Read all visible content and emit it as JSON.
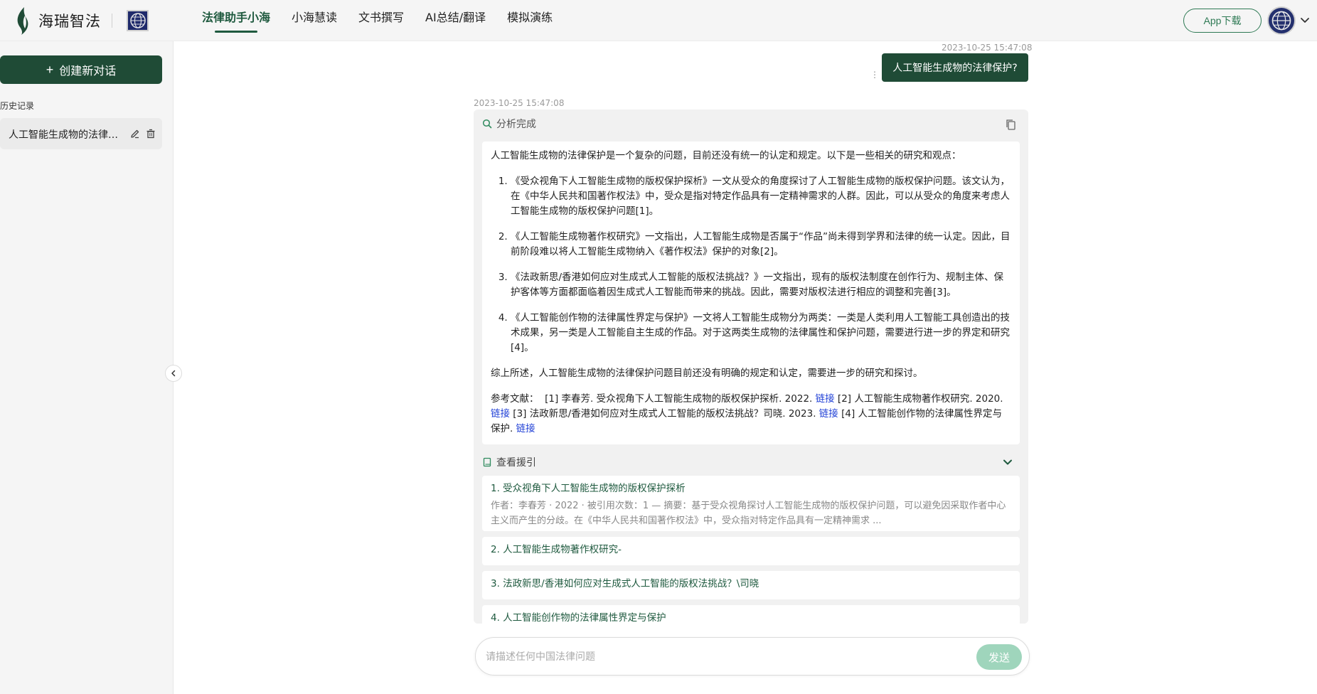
{
  "header": {
    "logo_text": "海瑞智法",
    "nav": [
      {
        "label": "法律助手小海",
        "active": true
      },
      {
        "label": "小海慧读",
        "active": false
      },
      {
        "label": "文书撰写",
        "active": false
      },
      {
        "label": "AI总结/翻译",
        "active": false
      },
      {
        "label": "模拟演练",
        "active": false
      }
    ],
    "app_download": "App下载"
  },
  "sidebar": {
    "new_chat": "创建新对话",
    "history_label": "历史记录",
    "history_items": [
      {
        "label": "人工智能生成物的法律保护?"
      }
    ]
  },
  "conversation": {
    "user_time": "2023-10-25 15:47:08",
    "user_message": "人工智能生成物的法律保护?",
    "answer_time": "2023-10-25 15:47:08",
    "status": "分析完成",
    "intro": "人工智能生成物的法律保护是一个复杂的问题，目前还没有统一的认定和规定。以下是一些相关的研究和观点：",
    "points": [
      "《受众视角下人工智能生成物的版权保护探析》一文从受众的角度探讨了人工智能生成物的版权保护问题。该文认为，在《中华人民共和国著作权法》中，受众是指对特定作品具有一定精神需求的人群。因此，可以从受众的角度来考虑人工智能生成物的版权保护问题[1]。",
      "《人工智能生成物著作权研究》一文指出，人工智能生成物是否属于“作品”尚未得到学界和法律的统一认定。因此，目前阶段难以将人工智能生成物纳入《著作权法》保护的对象[2]。",
      "《法政新思/香港如何应对生成式人工智能的版权法挑战？》一文指出，现有的版权法制度在创作行为、规制主体、保护客体等方面都面临着因生成式人工智能而带来的挑战。因此，需要对版权法进行相应的调整和完善[3]。",
      "《人工智能创作物的法律属性界定与保护》一文将人工智能生成物分为两类：一类是人类利用人工智能工具创造出的技术成果，另一类是人工智能自主生成的作品。对于这两类生成物的法律属性和保护问题，需要进行进一步的界定和研究[4]。"
    ],
    "summary": "综上所述，人工智能生成物的法律保护问题目前还没有明确的规定和认定，需要进一步的研究和探讨。",
    "refs_prefix": "参考文献：",
    "ref_texts": [
      "[1] 李春芳. 受众视角下人工智能生成物的版权保护探析. 2022.",
      "[2] 人工智能生成物著作权研究. 2020.",
      "[3] 法政新思/香港如何应对生成式人工智能的版权法挑战？司晓. 2023.",
      "[4] 人工智能创作物的法律属性界定与保护."
    ],
    "link_label": "链接",
    "citations_label": "查看援引",
    "citations": [
      {
        "title": "1. 受众视角下人工智能生成物的版权保护探析",
        "meta": "作者：李春芳 · 2022 · 被引用次数：1 — 摘要：基于受众视角探讨人工智能生成物的版权保护问题，可以避免因采取作者中心主义而产生的分歧。在《中华人民共和国著作权法》中，受众指对特定作品具有一定精神需求 ..."
      },
      {
        "title": "2. 人工智能生成物著作权研究-"
      },
      {
        "title": "3. 法政新思/香港如何应对生成式人工智能的版权法挑战？\\司晓"
      },
      {
        "title": "4. 人工智能创作物的法律属性界定与保护"
      }
    ]
  },
  "input": {
    "placeholder": "请描述任何中国法律问题",
    "send": "发送"
  },
  "colors": {
    "brand": "#1f4b36",
    "active_nav": "#1f5a3f",
    "link": "#1f3fd6",
    "send_disabled": "#9fd5bc"
  }
}
